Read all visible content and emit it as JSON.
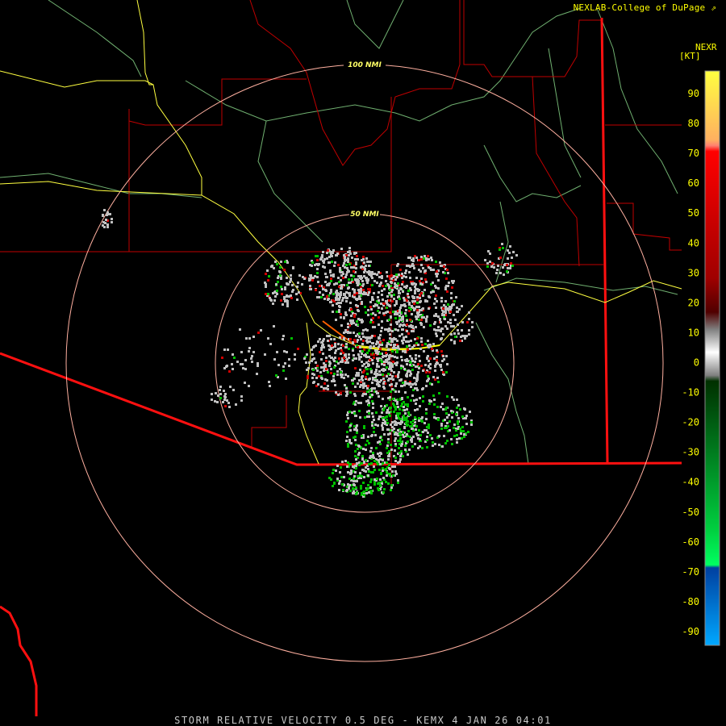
{
  "credit": "NEXLAB-College of DuPage",
  "legend": {
    "product_code": "NEXR",
    "unit": "[KT]",
    "ticks": [
      "90",
      "80",
      "70",
      "60",
      "50",
      "40",
      "30",
      "20",
      "10",
      "0",
      "-10",
      "-20",
      "-30",
      "-40",
      "-50",
      "-60",
      "-70",
      "-80",
      "-90"
    ]
  },
  "range_rings": [
    "50 NMI",
    "100 NMI"
  ],
  "caption": "STORM RELATIVE VELOCITY 0.5 DEG - KEMX 4 JAN 26 04:01",
  "colors": {
    "ring": "#ffb0a0",
    "county_border": "#d00000",
    "state_border": "#ff1010",
    "highway": "#ffff40",
    "river": "#80c080",
    "inbound": "#00c000",
    "outbound": "#d00000",
    "near_zero": "#c0c0c0"
  }
}
